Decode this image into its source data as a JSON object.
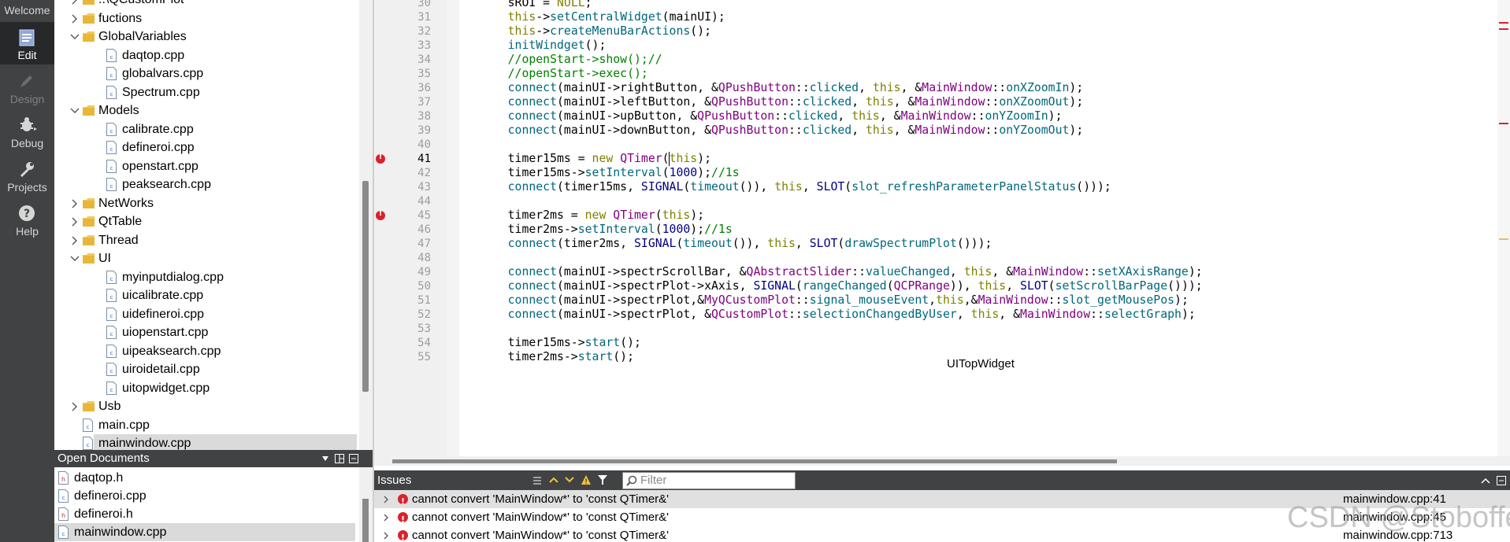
{
  "modebar": {
    "items": [
      {
        "label": "Welcome",
        "icon": "welcome-icon",
        "state": "normal"
      },
      {
        "label": "Edit",
        "icon": "edit-icon",
        "state": "active"
      },
      {
        "label": "Design",
        "icon": "design-icon",
        "state": "disabled"
      },
      {
        "label": "Debug",
        "icon": "debug-icon",
        "state": "normal"
      },
      {
        "label": "Projects",
        "icon": "projects-icon",
        "state": "normal"
      },
      {
        "label": "Help",
        "icon": "help-icon",
        "state": "normal"
      }
    ]
  },
  "project_tree": {
    "rows": [
      {
        "label": "..\\QCustomPlot",
        "kind": "folder",
        "expanded": false,
        "depth": 1
      },
      {
        "label": "fuctions",
        "kind": "folder",
        "expanded": false,
        "depth": 1
      },
      {
        "label": "GlobalVariables",
        "kind": "folder",
        "expanded": true,
        "depth": 1
      },
      {
        "label": "daqtop.cpp",
        "kind": "file",
        "depth": 2
      },
      {
        "label": "globalvars.cpp",
        "kind": "file",
        "depth": 2
      },
      {
        "label": "Spectrum.cpp",
        "kind": "file",
        "depth": 2
      },
      {
        "label": "Models",
        "kind": "folder",
        "expanded": true,
        "depth": 1
      },
      {
        "label": "calibrate.cpp",
        "kind": "file",
        "depth": 2
      },
      {
        "label": "defineroi.cpp",
        "kind": "file",
        "depth": 2
      },
      {
        "label": "openstart.cpp",
        "kind": "file",
        "depth": 2
      },
      {
        "label": "peaksearch.cpp",
        "kind": "file",
        "depth": 2
      },
      {
        "label": "NetWorks",
        "kind": "folder",
        "expanded": false,
        "depth": 1
      },
      {
        "label": "QtTable",
        "kind": "folder",
        "expanded": false,
        "depth": 1
      },
      {
        "label": "Thread",
        "kind": "folder",
        "expanded": false,
        "depth": 1
      },
      {
        "label": "UI",
        "kind": "folder",
        "expanded": true,
        "depth": 1
      },
      {
        "label": "myinputdialog.cpp",
        "kind": "file",
        "depth": 2
      },
      {
        "label": "uicalibrate.cpp",
        "kind": "file",
        "depth": 2
      },
      {
        "label": "uidefineroi.cpp",
        "kind": "file",
        "depth": 2
      },
      {
        "label": "uiopenstart.cpp",
        "kind": "file",
        "depth": 2
      },
      {
        "label": "uipeaksearch.cpp",
        "kind": "file",
        "depth": 2
      },
      {
        "label": "uiroidetail.cpp",
        "kind": "file",
        "depth": 2
      },
      {
        "label": "uitopwidget.cpp",
        "kind": "file",
        "depth": 2
      },
      {
        "label": "Usb",
        "kind": "folder",
        "expanded": false,
        "depth": 1
      },
      {
        "label": "main.cpp",
        "kind": "file",
        "depth": 1
      },
      {
        "label": "mainwindow.cpp",
        "kind": "file",
        "depth": 1,
        "selected": true
      }
    ]
  },
  "open_documents": {
    "title": "Open Documents",
    "items": [
      {
        "label": "daqtop.h",
        "kind": "header"
      },
      {
        "label": "defineroi.cpp",
        "kind": "source"
      },
      {
        "label": "defineroi.h",
        "kind": "header"
      },
      {
        "label": "mainwindow.cpp",
        "kind": "source",
        "selected": true
      }
    ]
  },
  "editor": {
    "tooltip": "UITopWidget",
    "lines": [
      {
        "n": "30",
        "code": "    sROI = NULL;"
      },
      {
        "n": "31",
        "code": "    this->setCentralWidget(mainUI);"
      },
      {
        "n": "32",
        "code": "    this->createMenuBarActions();"
      },
      {
        "n": "33",
        "code": "    initWindget();"
      },
      {
        "n": "34",
        "code": "    //openStart->show();//"
      },
      {
        "n": "35",
        "code": "    //openStart->exec();"
      },
      {
        "n": "36",
        "code": "    connect(mainUI->rightButton, &QPushButton::clicked, this, &MainWindow::onXZoomIn);"
      },
      {
        "n": "37",
        "code": "    connect(mainUI->leftButton, &QPushButton::clicked, this, &MainWindow::onXZoomOut);"
      },
      {
        "n": "38",
        "code": "    connect(mainUI->upButton, &QPushButton::clicked, this, &MainWindow::onYZoomIn);"
      },
      {
        "n": "39",
        "code": "    connect(mainUI->downButton, &QPushButton::clicked, this, &MainWindow::onYZoomOut);"
      },
      {
        "n": "40",
        "code": ""
      },
      {
        "n": "41",
        "code": "    timer15ms = new QTimer(this);",
        "error": true,
        "current": true
      },
      {
        "n": "42",
        "code": "    timer15ms->setInterval(1000);//1s"
      },
      {
        "n": "43",
        "code": "    connect(timer15ms, SIGNAL(timeout()), this, SLOT(slot_refreshParameterPanelStatus()));"
      },
      {
        "n": "44",
        "code": ""
      },
      {
        "n": "45",
        "code": "    timer2ms = new QTimer(this);",
        "error": true
      },
      {
        "n": "46",
        "code": "    timer2ms->setInterval(1000);//1s"
      },
      {
        "n": "47",
        "code": "    connect(timer2ms, SIGNAL(timeout()), this, SLOT(drawSpectrumPlot()));"
      },
      {
        "n": "48",
        "code": ""
      },
      {
        "n": "49",
        "code": "    connect(mainUI->spectrScrollBar, &QAbstractSlider::valueChanged, this, &MainWindow::setXAxisRange);"
      },
      {
        "n": "50",
        "code": "    connect(mainUI->spectrPlot->xAxis, SIGNAL(rangeChanged(QCPRange)), this, SLOT(setScrollBarPage()));"
      },
      {
        "n": "51",
        "code": "    connect(mainUI->spectrPlot,&MyQCustomPlot::signal_mouseEvent,this,&MainWindow::slot_getMousePos);"
      },
      {
        "n": "52",
        "code": "    connect(mainUI->spectrPlot, &QCustomPlot::selectionChangedByUser, this, &MainWindow::selectGraph);"
      },
      {
        "n": "53",
        "code": ""
      },
      {
        "n": "54",
        "code": "    timer15ms->start();"
      },
      {
        "n": "55",
        "code": "    timer2ms->start();"
      }
    ]
  },
  "issues": {
    "title": "Issues",
    "filter_placeholder": "Filter",
    "items": [
      {
        "message": "cannot convert 'MainWindow*' to 'const QTimer&'",
        "location": "mainwindow.cpp:41",
        "selected": true
      },
      {
        "message": "cannot convert 'MainWindow*' to 'const QTimer&'",
        "location": "mainwindow.cpp:45"
      },
      {
        "message": "cannot convert 'MainWindow*' to 'const QTimer&'",
        "location": "mainwindow.cpp:713"
      }
    ]
  },
  "watermark": "CSDN @Stoboffe",
  "colors": {
    "modebar_bg": "#404244",
    "modebar_active": "#262829",
    "error_red": "#d9222b",
    "keyword": "#808000",
    "function": "#00677c",
    "type": "#800080",
    "comment": "#008000",
    "number": "#000080"
  }
}
